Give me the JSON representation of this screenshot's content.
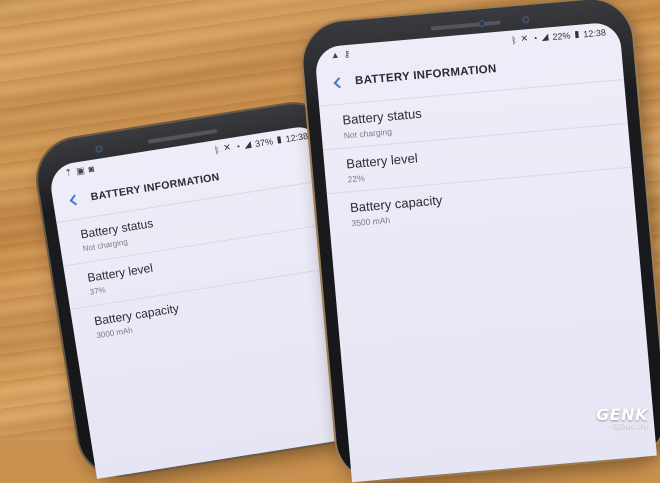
{
  "phone_small": {
    "status_right": {
      "battery_percent": "37%",
      "time": "12:38"
    },
    "status_left_icons": [
      "upload-icon",
      "image-icon",
      "notification-icon"
    ],
    "title": "BATTERY INFORMATION",
    "rows": [
      {
        "label": "Battery status",
        "value": "Not charging"
      },
      {
        "label": "Battery level",
        "value": "37%"
      },
      {
        "label": "Battery capacity",
        "value": "3000 mAh"
      }
    ]
  },
  "phone_large": {
    "status_right": {
      "battery_percent": "22%",
      "time": "12:38"
    },
    "status_left_icons": [
      "warning-icon",
      "key-icon"
    ],
    "title": "BATTERY INFORMATION",
    "rows": [
      {
        "label": "Battery status",
        "value": "Not charging"
      },
      {
        "label": "Battery level",
        "value": "22%"
      },
      {
        "label": "Battery capacity",
        "value": "3500 mAh"
      }
    ]
  },
  "watermark": {
    "logo": "GENK",
    "site": "GENK.VN"
  },
  "colors": {
    "accent": "#4a79c9",
    "screen": "#eeedf8",
    "wood": "#c9914f"
  }
}
